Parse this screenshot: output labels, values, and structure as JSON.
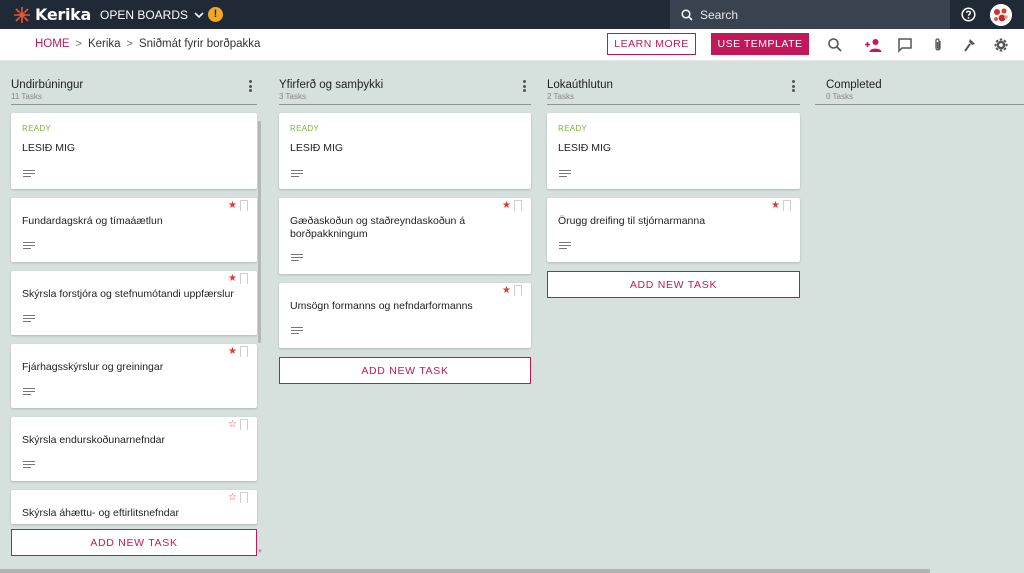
{
  "topbar": {
    "app_name": "Kerika",
    "open_boards_label": "OPEN BOARDS",
    "warning_badge": "!",
    "search_placeholder": "Search"
  },
  "breadcrumb": {
    "home": "HOME",
    "org": "Kerika",
    "board": "Sniðmát fyrir borðpakka"
  },
  "toolbar": {
    "learn_more_label": "LEARN MORE",
    "use_template_label": "USE TEMPLATE",
    "icons": [
      "search-icon",
      "add-person-icon",
      "chat-icon",
      "attachment-icon",
      "tools-icon",
      "settings-icon"
    ]
  },
  "colors": {
    "accent": "#c2185b",
    "topbar": "#1f2a36",
    "board_bg": "#d6e0dc",
    "ready": "#7cb342",
    "star": "#e53935"
  },
  "columns": [
    {
      "title": "Undirbúningur",
      "count": "11 Tasks",
      "add_label": "ADD NEW TASK",
      "cards": [
        {
          "status": "READY",
          "title": "LESIÐ MIG"
        },
        {
          "title": "Fundardagskrá og tímaáætlun",
          "star": "★"
        },
        {
          "title": "Skýrsla forstjóra og stefnumótandi uppfærslur",
          "star": "★"
        },
        {
          "title": "Fjárhagsskýrslur og greiningar",
          "star": "★"
        },
        {
          "title": "Skýrsla endurskoðunarnefndar",
          "star": "☆"
        },
        {
          "title": "Skýrsla áhættu- og eftirlitsnefndar",
          "star": "☆"
        }
      ]
    },
    {
      "title": "Yfirferð og samþykki",
      "count": "3 Tasks",
      "add_label": "ADD NEW TASK",
      "cards": [
        {
          "status": "READY",
          "title": "LESIÐ MIG"
        },
        {
          "title": "Gæðaskoðun og staðreyndaskoðun á borðpakkningum",
          "star": "★"
        },
        {
          "title": "Umsögn formanns og nefndarformanns",
          "star": "★"
        }
      ]
    },
    {
      "title": "Lokaúthlutun",
      "count": "2 Tasks",
      "add_label": "ADD NEW TASK",
      "cards": [
        {
          "status": "READY",
          "title": "LESIÐ MIG"
        },
        {
          "title": "Örugg dreifing til stjórnarmanna",
          "star": "★"
        }
      ]
    },
    {
      "title": "Completed",
      "count": "0 Tasks",
      "cards": []
    }
  ]
}
